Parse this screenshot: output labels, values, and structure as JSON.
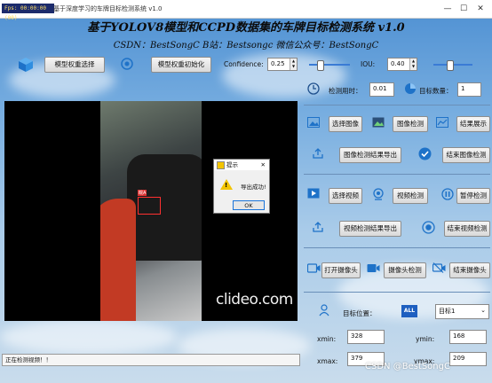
{
  "window": {
    "fps_badge": "Fps: 00:00:00 (00)",
    "title": "基于深度学习的车牌目标检测系统 v1.0",
    "controls": [
      "—",
      "☐",
      "✕"
    ]
  },
  "header": {
    "title": "基于YOLOV8模型和CCPD数据集的车牌目标检测系统 v1.0",
    "subtitle": "CSDN：BestSongC  B站：Bestsongc  微信公众号：BestSongC"
  },
  "toolbar": {
    "model_select": "模型权重选择",
    "model_init": "模型权重初始化",
    "confidence_label": "Confidence:",
    "confidence_value": "0.25",
    "confidence_level": 0.25,
    "iou_label": "IOU:",
    "iou_value": "0.40",
    "iou_level": 0.4
  },
  "video": {
    "plate_label": "皖A",
    "watermark": "clideo.com"
  },
  "dialog": {
    "title": "提示",
    "close": "✕",
    "message": "导出成功!",
    "ok": "OK"
  },
  "stats": {
    "time_label": "检测用时：",
    "time_value": "0.01",
    "count_label": "目标数量：",
    "count_value": "1"
  },
  "image_section": {
    "select": "选择图像",
    "detect": "图像检测",
    "show": "结果展示",
    "export": "图像检测结果导出",
    "end": "结束图像检测"
  },
  "video_section": {
    "select": "选择视频",
    "detect": "视频检测",
    "pause": "暂停检测",
    "export": "视频检测结果导出",
    "end": "结束视频检测"
  },
  "camera_section": {
    "open": "打开摄像头",
    "detect": "摄像头检测",
    "end": "结束摄像头"
  },
  "target": {
    "position_label": "目标位置：",
    "all_badge": "ALL",
    "select_value": "目标1",
    "xmin_label": "xmin:",
    "xmin_value": "328",
    "ymin_label": "ymin:",
    "ymin_value": "168",
    "xmax_label": "xmax:",
    "xmax_value": "379",
    "ymax_label": "ymax:",
    "ymax_value": "209"
  },
  "status": {
    "text": "正在检测视频！！"
  },
  "footer_watermark": "CSDN @BestSongC"
}
